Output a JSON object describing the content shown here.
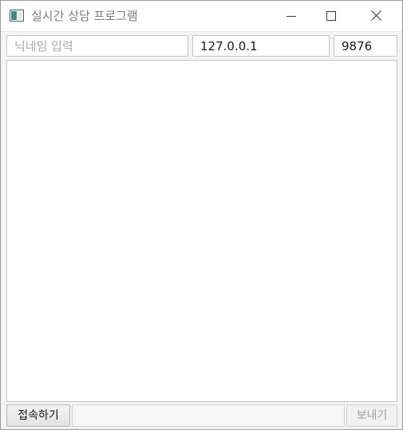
{
  "window": {
    "title": "실시간 상담 프로그램",
    "icon": "app-window-icon",
    "controls": [
      "minimize-icon",
      "maximize-icon",
      "close-icon"
    ]
  },
  "connection": {
    "nickname_placeholder": "닉네임 입력",
    "nickname_value": "",
    "ip_value": "127.0.0.1",
    "port_value": "9876"
  },
  "chat": {
    "messages": []
  },
  "bottom": {
    "connect_label": "접속하기",
    "message_value": "",
    "send_label": "보내기",
    "send_enabled": false
  }
}
